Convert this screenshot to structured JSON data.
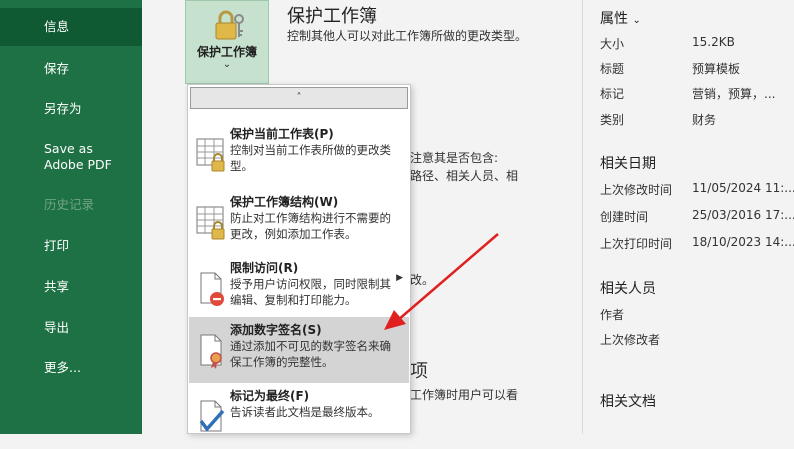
{
  "sidebar": {
    "items": [
      {
        "label": "信息",
        "active": true
      },
      {
        "label": "保存"
      },
      {
        "label": "另存为"
      },
      {
        "label": "Save as\nAdobe PDF"
      },
      {
        "label": "历史记录",
        "disabled": true
      },
      {
        "label": "打印"
      },
      {
        "label": "共享"
      },
      {
        "label": "导出"
      },
      {
        "label": "更多..."
      }
    ]
  },
  "protect": {
    "button_label": "保护工作簿",
    "title": "保护工作簿",
    "description": "控制其他人可以对此工作簿所做的更改类型。"
  },
  "background": {
    "line1": "注意其是否包含:",
    "line2": "路径、相关人员、相",
    "line3": "改。",
    "line4": "项",
    "line5": "工作簿时用户可以看"
  },
  "menu": {
    "scroll_up": "˄",
    "items": [
      {
        "title": "保护当前工作表(P)",
        "desc": "控制对当前工作表所做的更改类型。"
      },
      {
        "title": "保护工作簿结构(W)",
        "desc": "防止对工作簿结构进行不需要的更改，例如添加工作表。"
      },
      {
        "title": "限制访问(R)",
        "desc": "授予用户访问权限，同时限制其编辑、复制和打印能力。"
      },
      {
        "title": "添加数字签名(S)",
        "desc": "通过添加不可见的数字签名来确保工作簿的完整性。"
      },
      {
        "title": "标记为最终(F)",
        "desc": "告诉读者此文档是最终版本。"
      }
    ]
  },
  "properties": {
    "title": "属性",
    "rows": [
      {
        "label": "大小",
        "value": "15.2KB"
      },
      {
        "label": "标题",
        "value": "预算模板"
      },
      {
        "label": "标记",
        "value": "营销，预算，..."
      },
      {
        "label": "类别",
        "value": "财务"
      }
    ]
  },
  "dates": {
    "title": "相关日期",
    "rows": [
      {
        "label": "上次修改时间",
        "value": "11/05/2024 11:..."
      },
      {
        "label": "创建时间",
        "value": "25/03/2016 17:..."
      },
      {
        "label": "上次打印时间",
        "value": "18/10/2023 14:..."
      }
    ]
  },
  "people": {
    "title": "相关人员",
    "rows": [
      {
        "label": "作者"
      },
      {
        "label": "上次修改者"
      }
    ]
  },
  "docs": {
    "title": "相关文档"
  },
  "colors": {
    "sidebar": "#1e7145",
    "sidebar_active": "#0f5a32",
    "accent_red": "#e02020",
    "highlight": "#d4d4d4"
  }
}
